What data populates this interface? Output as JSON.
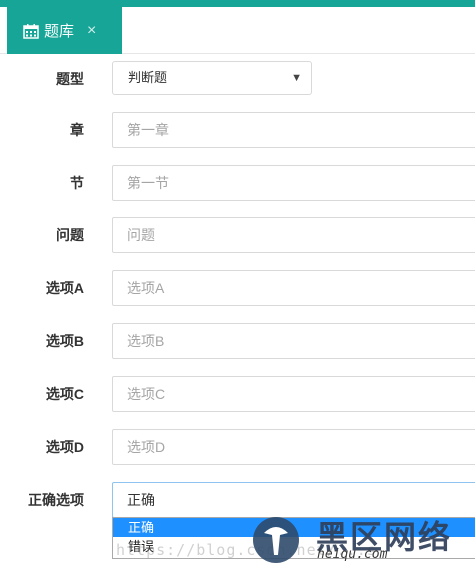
{
  "tab": {
    "label": "题库",
    "close": "×"
  },
  "form": {
    "type": {
      "label": "题型",
      "value": "判断题",
      "arrow": "▼"
    },
    "fields": [
      {
        "label": "章",
        "placeholder": "第一章"
      },
      {
        "label": "节",
        "placeholder": "第一节"
      },
      {
        "label": "问题",
        "placeholder": "问题"
      },
      {
        "label": "选项A",
        "placeholder": "选项A"
      },
      {
        "label": "选项B",
        "placeholder": "选项B"
      },
      {
        "label": "选项C",
        "placeholder": "选项C"
      },
      {
        "label": "选项D",
        "placeholder": "选项D"
      }
    ],
    "answer": {
      "label": "正确选项",
      "value": "正确",
      "options": [
        "正确",
        "错误"
      ]
    }
  },
  "watermark": {
    "url": "https://blog.csdn.net/...s",
    "brand": "黑区网络",
    "site": "heiqu.com"
  },
  "colors": {
    "accent": "#16a596",
    "option_selected": "#1e90ff"
  }
}
